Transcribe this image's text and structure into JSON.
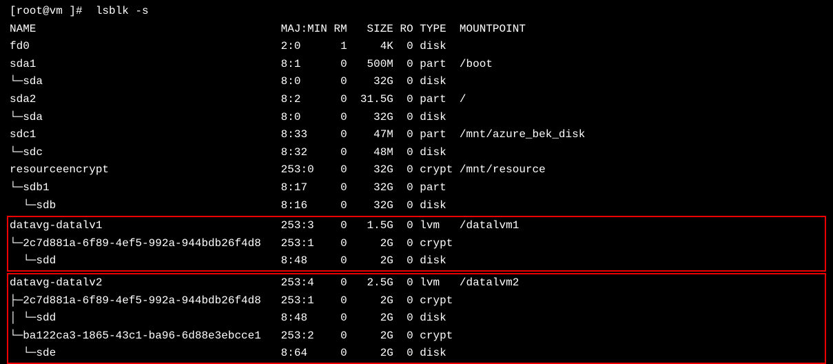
{
  "prompt": "[root@vm ]#  lsblk -s",
  "headers": {
    "name": "NAME",
    "majmin": "MAJ:MIN",
    "rm": "RM",
    "size": "SIZE",
    "ro": "RO",
    "type": "TYPE",
    "mountpoint": "MOUNTPOINT"
  },
  "rows": [
    {
      "name": "fd0",
      "majmin": "2:0",
      "rm": "1",
      "size": "4K",
      "ro": "0",
      "type": "disk",
      "mountpoint": ""
    },
    {
      "name": "sda1",
      "majmin": "8:1",
      "rm": "0",
      "size": "500M",
      "ro": "0",
      "type": "part",
      "mountpoint": "/boot"
    },
    {
      "name": "└─sda",
      "majmin": "8:0",
      "rm": "0",
      "size": "32G",
      "ro": "0",
      "type": "disk",
      "mountpoint": ""
    },
    {
      "name": "sda2",
      "majmin": "8:2",
      "rm": "0",
      "size": "31.5G",
      "ro": "0",
      "type": "part",
      "mountpoint": "/"
    },
    {
      "name": "└─sda",
      "majmin": "8:0",
      "rm": "0",
      "size": "32G",
      "ro": "0",
      "type": "disk",
      "mountpoint": ""
    },
    {
      "name": "sdc1",
      "majmin": "8:33",
      "rm": "0",
      "size": "47M",
      "ro": "0",
      "type": "part",
      "mountpoint": "/mnt/azure_bek_disk"
    },
    {
      "name": "└─sdc",
      "majmin": "8:32",
      "rm": "0",
      "size": "48M",
      "ro": "0",
      "type": "disk",
      "mountpoint": ""
    },
    {
      "name": "resourceencrypt",
      "majmin": "253:0",
      "rm": "0",
      "size": "32G",
      "ro": "0",
      "type": "crypt",
      "mountpoint": "/mnt/resource"
    },
    {
      "name": "└─sdb1",
      "majmin": "8:17",
      "rm": "0",
      "size": "32G",
      "ro": "0",
      "type": "part",
      "mountpoint": ""
    },
    {
      "name": "  └─sdb",
      "majmin": "8:16",
      "rm": "0",
      "size": "32G",
      "ro": "0",
      "type": "disk",
      "mountpoint": ""
    }
  ],
  "box1": [
    {
      "name": "datavg-datalv1",
      "majmin": "253:3",
      "rm": "0",
      "size": "1.5G",
      "ro": "0",
      "type": "lvm",
      "mountpoint": "/datalvm1"
    },
    {
      "name": "└─2c7d881a-6f89-4ef5-992a-944bdb26f4d8",
      "majmin": "253:1",
      "rm": "0",
      "size": "2G",
      "ro": "0",
      "type": "crypt",
      "mountpoint": ""
    },
    {
      "name": "  └─sdd",
      "majmin": "8:48",
      "rm": "0",
      "size": "2G",
      "ro": "0",
      "type": "disk",
      "mountpoint": ""
    }
  ],
  "box2": [
    {
      "name": "datavg-datalv2",
      "majmin": "253:4",
      "rm": "0",
      "size": "2.5G",
      "ro": "0",
      "type": "lvm",
      "mountpoint": "/datalvm2"
    },
    {
      "name": "├─2c7d881a-6f89-4ef5-992a-944bdb26f4d8",
      "majmin": "253:1",
      "rm": "0",
      "size": "2G",
      "ro": "0",
      "type": "crypt",
      "mountpoint": ""
    },
    {
      "name": "│ └─sdd",
      "majmin": "8:48",
      "rm": "0",
      "size": "2G",
      "ro": "0",
      "type": "disk",
      "mountpoint": ""
    },
    {
      "name": "└─ba122ca3-1865-43c1-ba96-6d88e3ebcce1",
      "majmin": "253:2",
      "rm": "0",
      "size": "2G",
      "ro": "0",
      "type": "crypt",
      "mountpoint": ""
    },
    {
      "name": "  └─sde",
      "majmin": "8:64",
      "rm": "0",
      "size": "2G",
      "ro": "0",
      "type": "disk",
      "mountpoint": ""
    }
  ],
  "chart_data": {
    "type": "table",
    "title": "lsblk -s output",
    "columns": [
      "NAME",
      "MAJ:MIN",
      "RM",
      "SIZE",
      "RO",
      "TYPE",
      "MOUNTPOINT"
    ],
    "rows": [
      [
        "fd0",
        "2:0",
        "1",
        "4K",
        "0",
        "disk",
        ""
      ],
      [
        "sda1",
        "8:1",
        "0",
        "500M",
        "0",
        "part",
        "/boot"
      ],
      [
        "└─sda",
        "8:0",
        "0",
        "32G",
        "0",
        "disk",
        ""
      ],
      [
        "sda2",
        "8:2",
        "0",
        "31.5G",
        "0",
        "part",
        "/"
      ],
      [
        "└─sda",
        "8:0",
        "0",
        "32G",
        "0",
        "disk",
        ""
      ],
      [
        "sdc1",
        "8:33",
        "0",
        "47M",
        "0",
        "part",
        "/mnt/azure_bek_disk"
      ],
      [
        "└─sdc",
        "8:32",
        "0",
        "48M",
        "0",
        "disk",
        ""
      ],
      [
        "resourceencrypt",
        "253:0",
        "0",
        "32G",
        "0",
        "crypt",
        "/mnt/resource"
      ],
      [
        "└─sdb1",
        "8:17",
        "0",
        "32G",
        "0",
        "part",
        ""
      ],
      [
        "  └─sdb",
        "8:16",
        "0",
        "32G",
        "0",
        "disk",
        ""
      ],
      [
        "datavg-datalv1",
        "253:3",
        "0",
        "1.5G",
        "0",
        "lvm",
        "/datalvm1"
      ],
      [
        "└─2c7d881a-6f89-4ef5-992a-944bdb26f4d8",
        "253:1",
        "0",
        "2G",
        "0",
        "crypt",
        ""
      ],
      [
        "  └─sdd",
        "8:48",
        "0",
        "2G",
        "0",
        "disk",
        ""
      ],
      [
        "datavg-datalv2",
        "253:4",
        "0",
        "2.5G",
        "0",
        "lvm",
        "/datalvm2"
      ],
      [
        "├─2c7d881a-6f89-4ef5-992a-944bdb26f4d8",
        "253:1",
        "0",
        "2G",
        "0",
        "crypt",
        ""
      ],
      [
        "│ └─sdd",
        "8:48",
        "0",
        "2G",
        "0",
        "disk",
        ""
      ],
      [
        "└─ba122ca3-1865-43c1-ba96-6d88e3ebcce1",
        "253:2",
        "0",
        "2G",
        "0",
        "crypt",
        ""
      ],
      [
        "  └─sde",
        "8:64",
        "0",
        "2G",
        "0",
        "disk",
        ""
      ]
    ]
  }
}
